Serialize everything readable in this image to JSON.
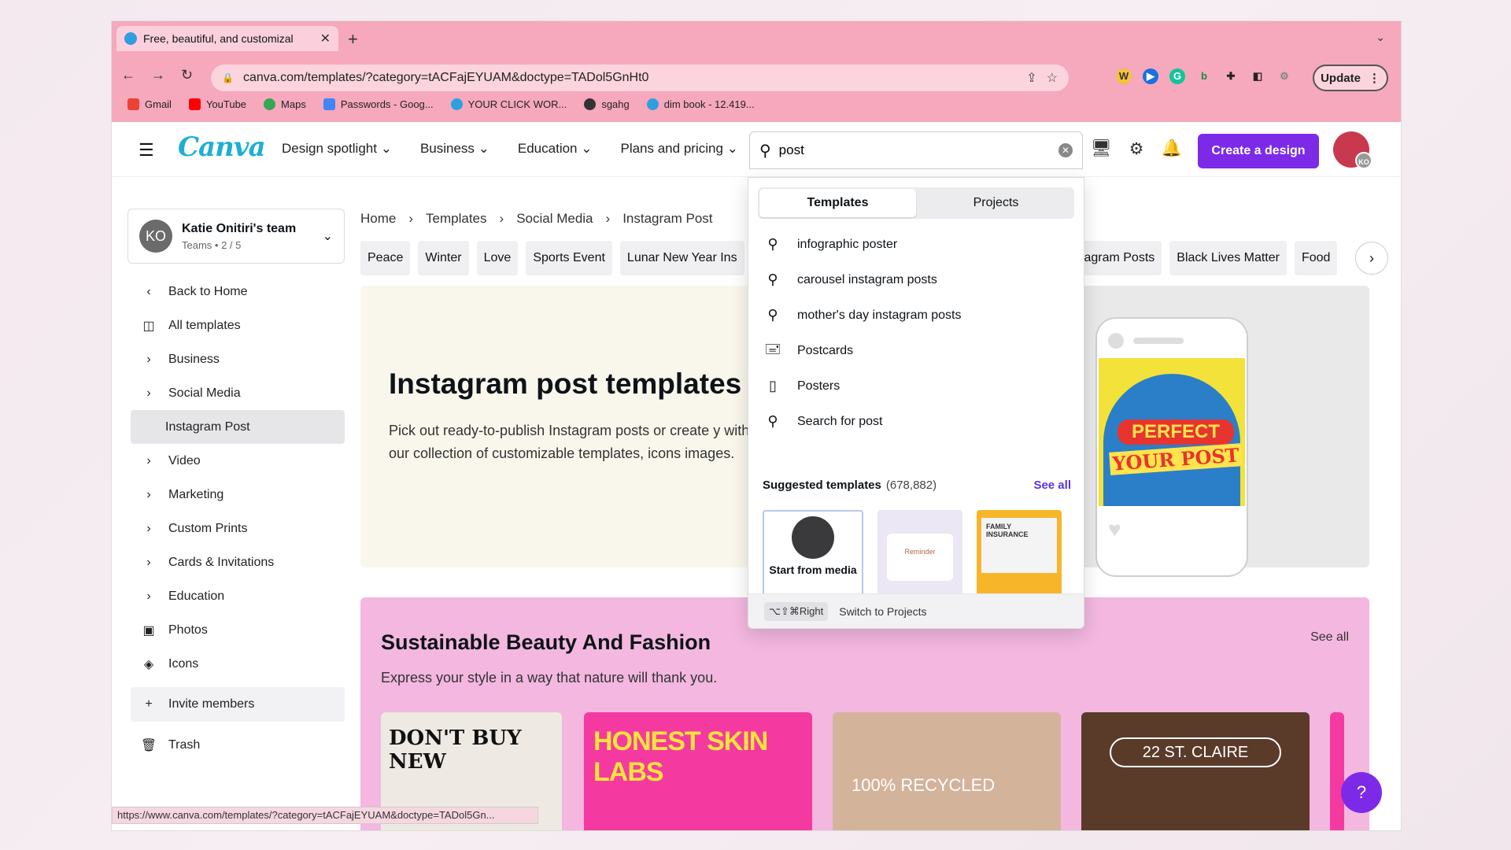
{
  "browser": {
    "tab_title": "Free, beautiful, and customizal",
    "url": "canva.com/templates/?category=tACFajEYUAM&doctype=TADol5GnHt0",
    "update_label": "Update",
    "bookmarks": [
      {
        "label": "Gmail",
        "color": "#ea4335"
      },
      {
        "label": "YouTube",
        "color": "#ff0000"
      },
      {
        "label": "Maps",
        "color": "#34a853"
      },
      {
        "label": "Passwords - Goog...",
        "color": "#4285f4"
      },
      {
        "label": "YOUR CLICK WOR...",
        "color": "#2f9fe0"
      },
      {
        "label": "sgahg",
        "color": "#333333"
      },
      {
        "label": "dim book - 12.419...",
        "color": "#2f9fe0"
      }
    ],
    "status_url": "https://www.canva.com/templates/?category=tACFajEYUAM&doctype=TADol5Gn..."
  },
  "header": {
    "logo": "Canva",
    "nav": [
      "Design spotlight",
      "Business",
      "Education",
      "Plans and pricing"
    ],
    "search_value": "post",
    "create_label": "Create a design",
    "avatar_initials": "KO",
    "accent": "#7d2ae8"
  },
  "team": {
    "initials": "KO",
    "name": "Katie Onitiri's team",
    "sub": "Teams • 2 / 5"
  },
  "sidebar": {
    "back": "Back to Home",
    "all_templates": "All templates",
    "items": [
      "Business",
      "Social Media"
    ],
    "selected": "Instagram Post",
    "items2": [
      "Video",
      "Marketing",
      "Custom Prints",
      "Cards & Invitations",
      "Education"
    ],
    "photos": "Photos",
    "icons": "Icons",
    "invite": "Invite members",
    "trash": "Trash"
  },
  "breadcrumb": [
    "Home",
    "Templates",
    "Social Media",
    "Instagram Post"
  ],
  "chips": [
    "Peace",
    "Winter",
    "Love",
    "Sports Event",
    "Lunar New Year Ins"
  ],
  "chips_right": [
    "tagram Posts",
    "Black Lives Matter",
    "Food"
  ],
  "hero": {
    "title": "Instagram post templates",
    "desc": "Pick out ready-to-publish Instagram posts or create y with our collection of customizable templates, icons images.",
    "phone_line1": "PERFECT",
    "phone_line2": "YOUR POST"
  },
  "section": {
    "title": "Sustainable Beauty And Fashion",
    "see_all": "See all",
    "desc": "Express your style in a way that nature will thank you.",
    "cards": [
      "DON'T BUY NEW",
      "HONEST SKIN LABS",
      "100% RECYCLED",
      "22 ST. CLAIRE"
    ]
  },
  "dropdown": {
    "tabs": [
      "Templates",
      "Projects"
    ],
    "suggestions": [
      {
        "icon": "search-icon",
        "label": "infographic poster"
      },
      {
        "icon": "search-icon",
        "label": "carousel instagram posts"
      },
      {
        "icon": "search-icon",
        "label": "mother's day instagram posts"
      },
      {
        "icon": "postcard-icon",
        "label": "Postcards"
      },
      {
        "icon": "poster-icon",
        "label": "Posters"
      },
      {
        "icon": "search-icon",
        "label": "Search for post"
      }
    ],
    "suggested_title": "Suggested templates",
    "suggested_count": "(678,882)",
    "see_all": "See all",
    "start_label": "Start from media",
    "t2_text": "Reminder",
    "t3_text": "FAMILY INSURANCE",
    "shortcut": "⌥⇧⌘Right",
    "shortcut_label": "Switch to Projects"
  },
  "help": "?"
}
